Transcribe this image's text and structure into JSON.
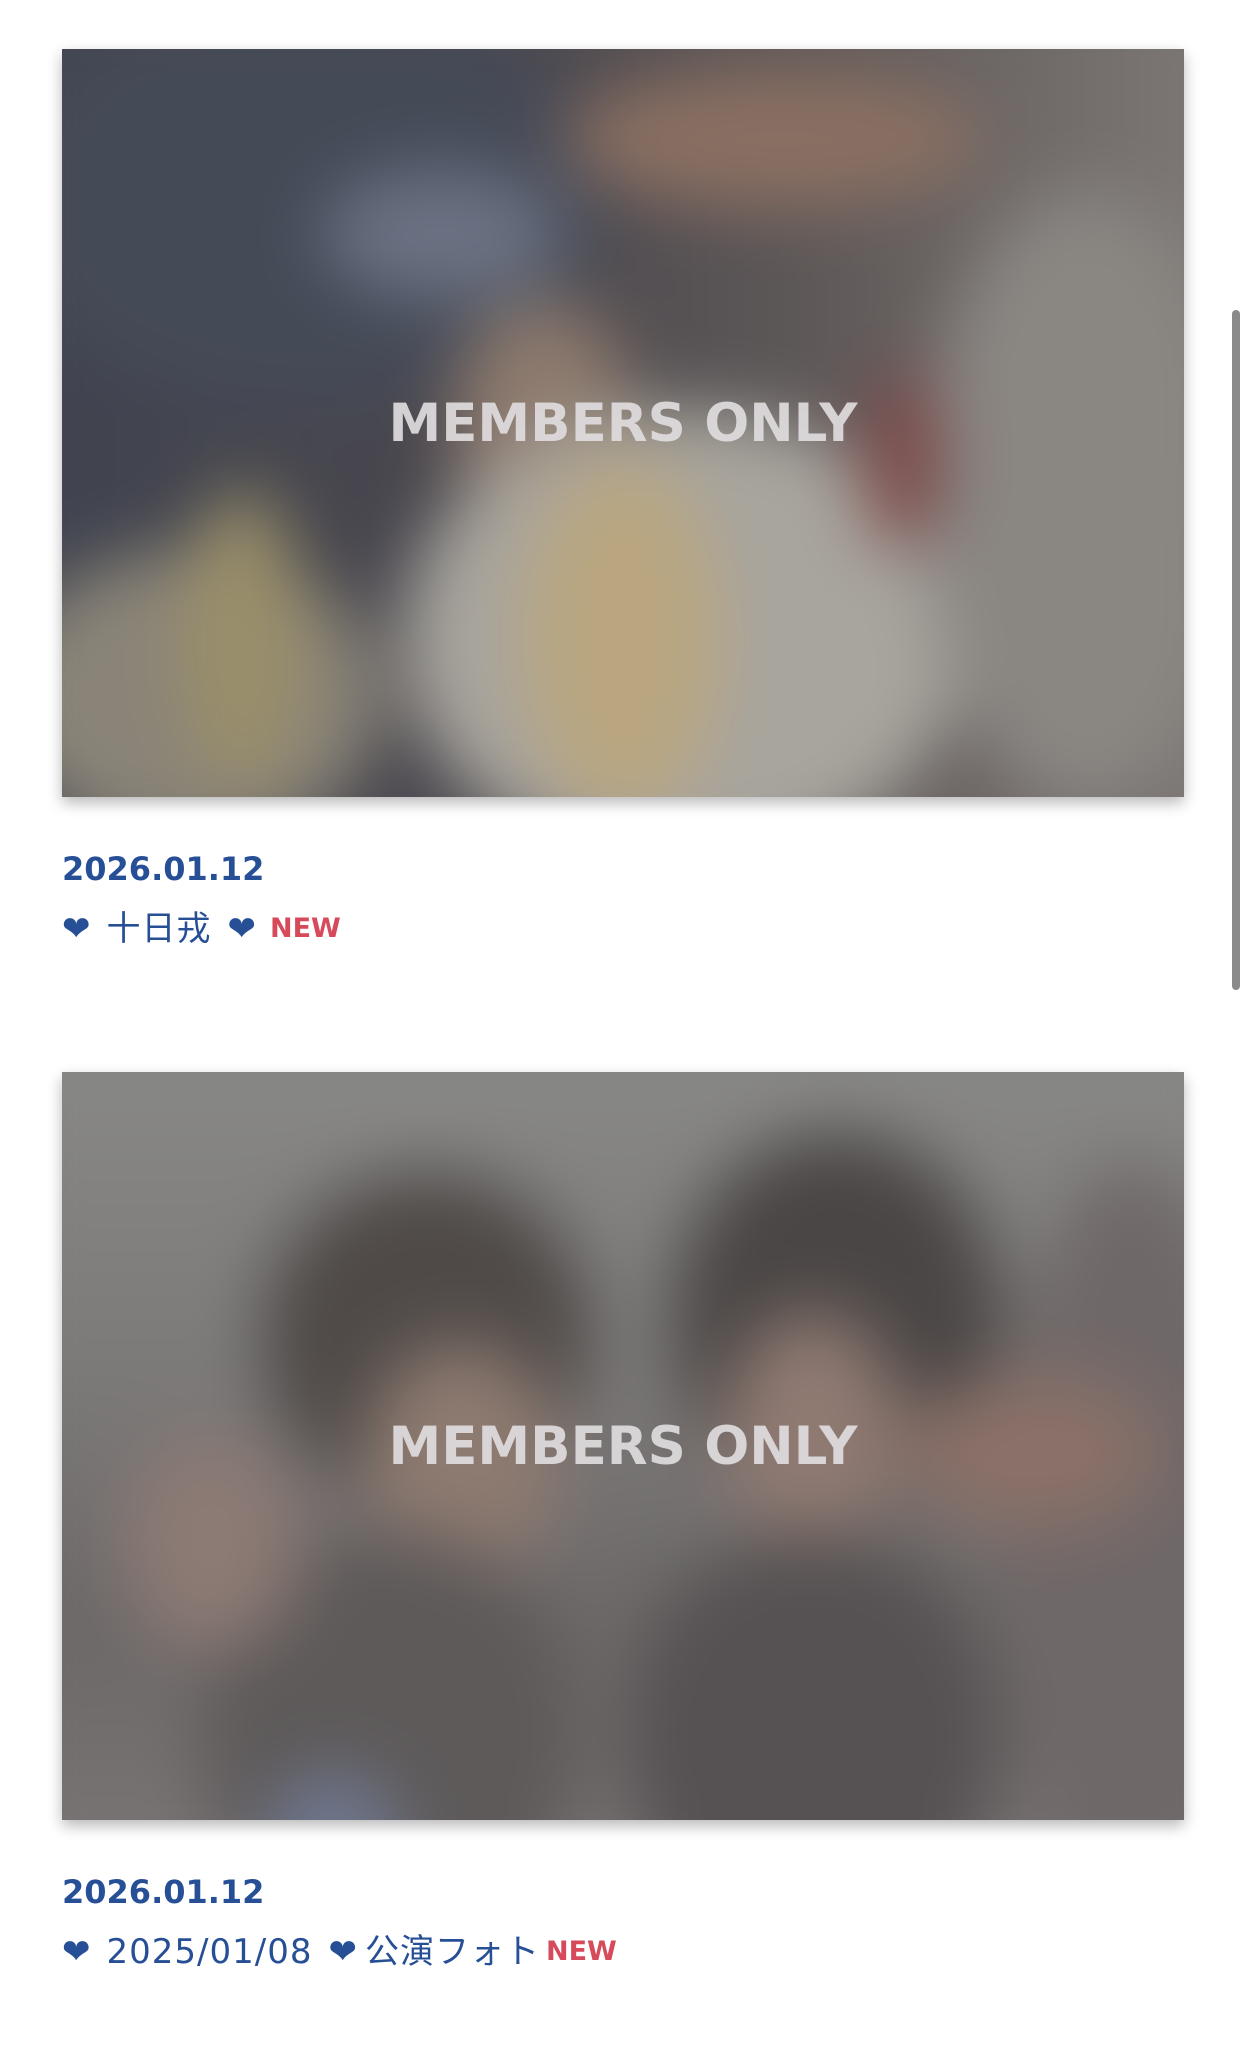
{
  "posts": [
    {
      "overlay_label": "MEMBERS ONLY",
      "date": "2026.01.12",
      "title_prefix_icon": "heart-icon",
      "title": "十日戎",
      "title_suffix_icon": "heart-icon",
      "badge": "NEW"
    },
    {
      "overlay_label": "MEMBERS ONLY",
      "date": "2026.01.12",
      "title_prefix_icon": "heart-icon",
      "title": "2025/01/08",
      "title_suffix_icon": "heart-icon",
      "subtitle": "公演フォト",
      "badge": "NEW"
    }
  ],
  "icons": {
    "heart_glyph": "❤"
  },
  "colors": {
    "date_text": "#274f96",
    "title_text": "#274f96",
    "badge_text": "#d64a5b",
    "overlay_text": "#e0dcde",
    "background": "#ffffff"
  },
  "scrollbar": {
    "position_fraction": 0.28
  }
}
